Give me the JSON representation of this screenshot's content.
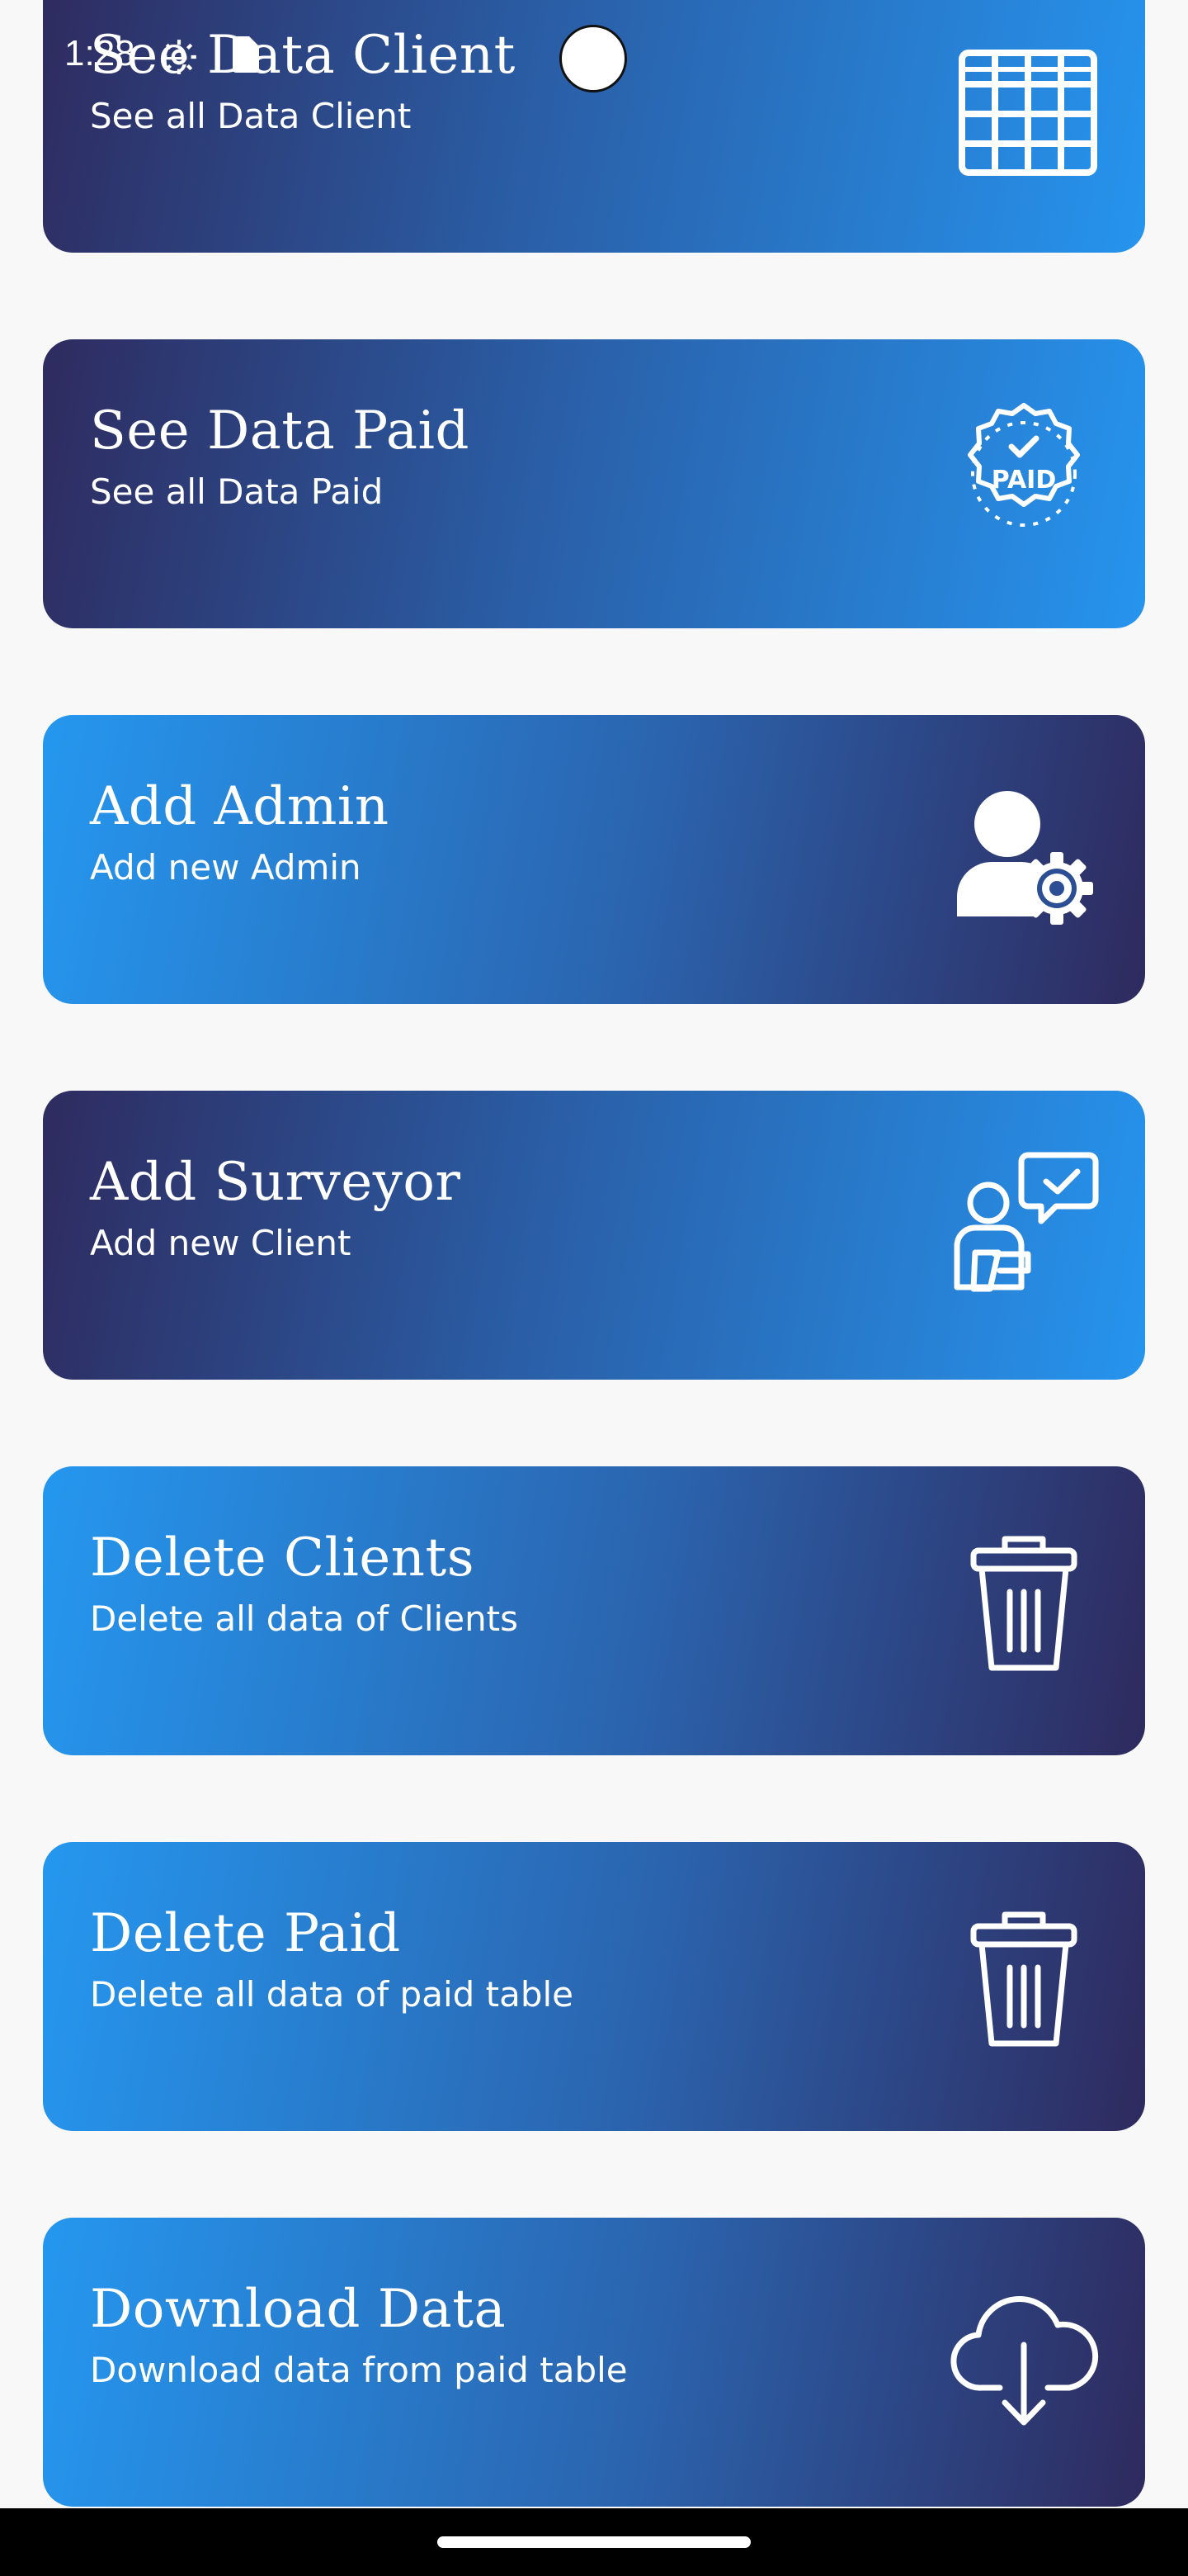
{
  "status_bar": {
    "time": "1:28",
    "icons": [
      "settings-icon",
      "sim-card-icon"
    ]
  },
  "menu": {
    "items": [
      {
        "title": "See Data Client",
        "subtitle": "See all Data Client",
        "icon": "table-icon"
      },
      {
        "title": "See Data Paid",
        "subtitle": "See all Data Paid",
        "icon": "paid-badge-icon",
        "icon_text": "PAID"
      },
      {
        "title": "Add Admin",
        "subtitle": "Add new Admin",
        "icon": "admin-user-gear-icon"
      },
      {
        "title": "Add Surveyor",
        "subtitle": "Add new Client",
        "icon": "surveyor-icon"
      },
      {
        "title": "Delete Clients",
        "subtitle": "Delete all data of Clients",
        "icon": "trash-icon"
      },
      {
        "title": "Delete Paid",
        "subtitle": "Delete all data of paid table",
        "icon": "trash-icon"
      },
      {
        "title": "Download Data",
        "subtitle": "Download data from paid table",
        "icon": "cloud-download-icon"
      }
    ]
  },
  "colors": {
    "background": "#f8f8f9",
    "gradient_dark": "#2e2b5f",
    "gradient_light": "#2694ee",
    "text": "#ffffff"
  }
}
